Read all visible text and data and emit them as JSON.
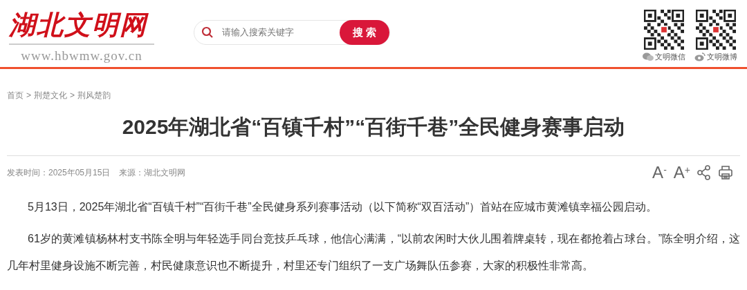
{
  "header": {
    "logo": "湖北文明网",
    "site_url": "www.hbwmw.gov.cn",
    "search": {
      "placeholder": "请输入搜索关键字",
      "button": "搜 索"
    },
    "qr_codes": [
      {
        "kind": "wechat",
        "label": "文明微信"
      },
      {
        "kind": "weibo",
        "label": "文明微博"
      }
    ]
  },
  "breadcrumb": [
    {
      "label": "首页"
    },
    {
      "separator": ">",
      "label": "荆楚文化"
    },
    {
      "separator": ">",
      "label": "荆风楚韵"
    }
  ],
  "article": {
    "title": "2025年湖北省“百镇千村”“百街千巷”全民健身赛事启动",
    "published": "发表时间：2025年05月15日",
    "source": "来源：湖北文明网",
    "tools": [
      {
        "kind": "font",
        "label": "A$^{-}$"
      },
      {
        "kind": "font",
        "label": "A$^{+}$"
      },
      {
        "kind": "share"
      },
      {
        "kind": "print"
      }
    ],
    "paragraphs": [
      "5月13日，2025年湖北省“百镇千村”“百街千巷”全民健身系列赛事活动（以下简称“双百活动”）首站在应城市黄滩镇幸福公园启动。",
      "61岁的黄滩镇杨林村支书陈全明与年轻选手同台竞技乒乓球，他信心满满，“以前农闲时大伙儿围着牌桌转，现在都抢着占球台。”陈全明介绍，这几年村里健身设施不断完善，村民健康意识也不断提升，村里还专门组织了一支广场舞队伍参赛，大家的积极性非常高。"
    ]
  }
}
